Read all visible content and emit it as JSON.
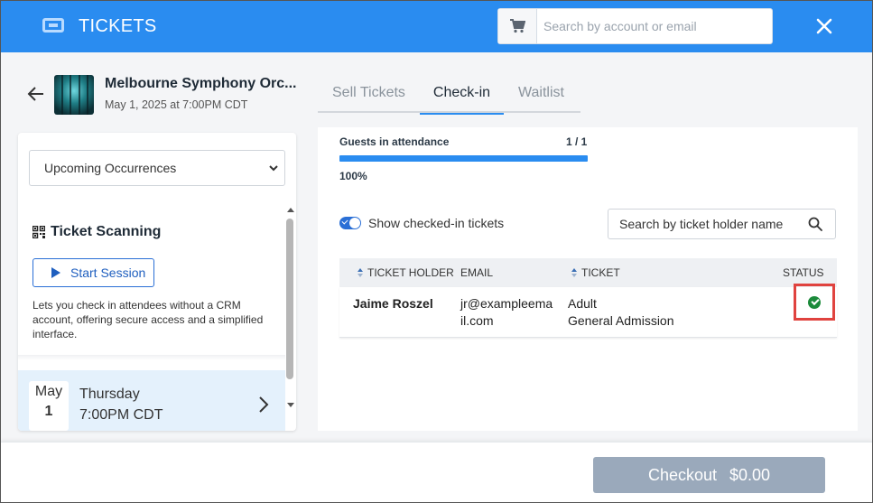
{
  "header": {
    "title": "TICKETS",
    "search_placeholder": "Search by account or email",
    "icons": {
      "logo": "ticket-icon",
      "cart": "cart-icon",
      "close": "close-icon"
    }
  },
  "event": {
    "name": "Melbourne Symphony Orc...",
    "date": "May 1, 2025 at 7:00PM CDT"
  },
  "tabs": [
    {
      "label": "Sell Tickets",
      "active": false
    },
    {
      "label": "Check-in",
      "active": true
    },
    {
      "label": "Waitlist",
      "active": false
    }
  ],
  "sidebar": {
    "occurrence_select": "Upcoming Occurrences",
    "scanning": {
      "title": "Ticket Scanning",
      "button": "Start Session",
      "description": "Lets you check in attendees without a CRM account, offering secure access and a simplified interface."
    },
    "occurrence": {
      "month": "May",
      "day": "1",
      "weekday": "Thursday",
      "time": "7:00PM CDT"
    }
  },
  "checkin": {
    "attendance_label": "Guests in attendance",
    "attendance_count": "1 / 1",
    "progress_fraction": 1.0,
    "progress_text": "100%",
    "toggle_label": "Show checked-in tickets",
    "toggle_on": true,
    "holder_search_placeholder": "Search by ticket holder name",
    "table": {
      "headers": {
        "holder": "TICKET HOLDER",
        "email": "EMAIL",
        "ticket": "TICKET",
        "status": "STATUS"
      },
      "rows": [
        {
          "holder": "Jaime Roszel",
          "email_line1": "jr@exampleema",
          "email_line2": "il.com",
          "ticket_line1": "Adult",
          "ticket_line2": "General Admission",
          "status": "checked-in"
        }
      ]
    }
  },
  "footer": {
    "checkout_label": "Checkout",
    "checkout_amount": "$0.00"
  },
  "colors": {
    "header_bg": "#2a8cf0",
    "accent": "#2a6fd6",
    "status_ok": "#1b8a3a",
    "highlight_border": "#e0433f",
    "checkout_bg": "#9aa9bb"
  }
}
